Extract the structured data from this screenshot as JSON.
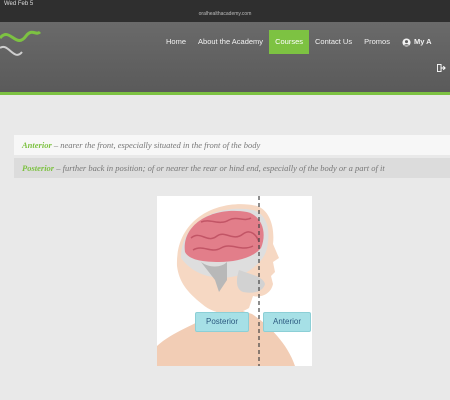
{
  "status_bar": {
    "date": "Wed Feb 5",
    "url": "oralhealthacademy.com"
  },
  "nav": {
    "items": [
      {
        "label": "Home"
      },
      {
        "label": "About the Academy"
      },
      {
        "label": "Courses",
        "active": true
      },
      {
        "label": "Contact Us"
      },
      {
        "label": "Promos"
      }
    ],
    "account_label": "My A"
  },
  "definitions": [
    {
      "term": "Anterior",
      "description": " – nearer the front, especially situated in the front of the body"
    },
    {
      "term": "Posterior",
      "description": " – further back in position; of or nearer the rear or hind end, especially of the body or a part of it"
    }
  ],
  "figure": {
    "labels": [
      "Posterior",
      "Anterior"
    ]
  },
  "colors": {
    "accent": "#7dc242",
    "header": "#5f5f5f",
    "background": "#e9e9e9"
  },
  "icons": [
    "logo-wave",
    "user-icon",
    "logout-icon"
  ]
}
